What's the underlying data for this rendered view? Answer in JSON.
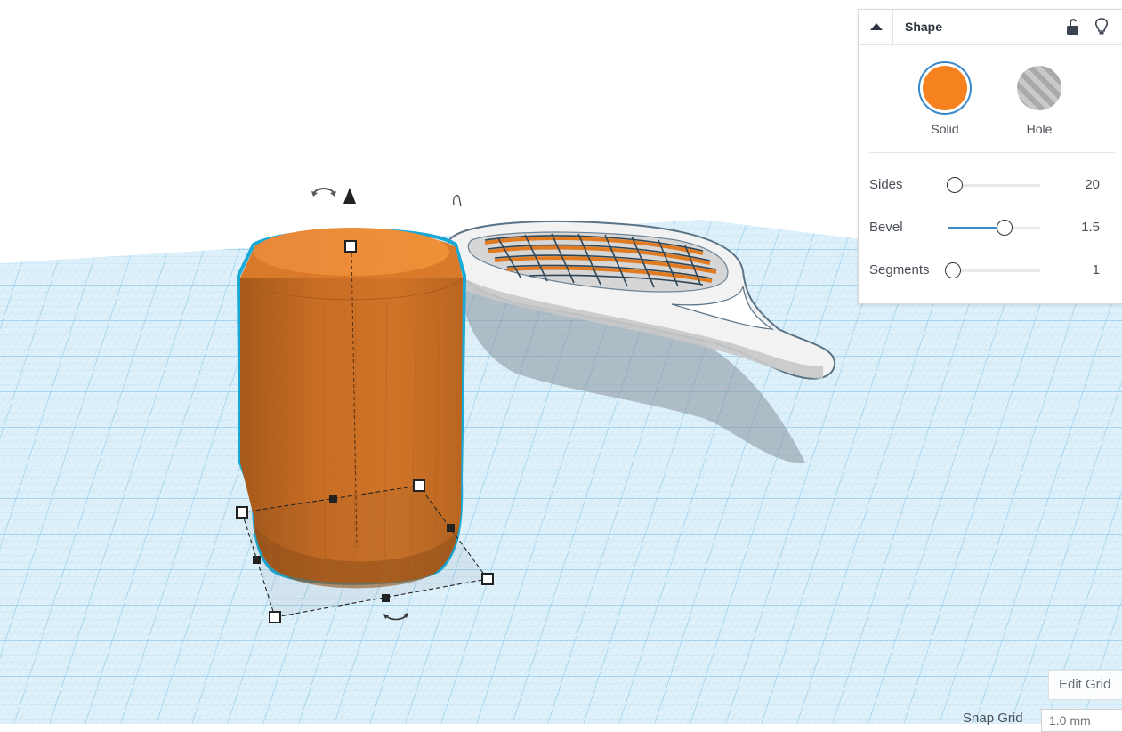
{
  "shape_panel": {
    "title": "Shape",
    "solid_label": "Solid",
    "hole_label": "Hole",
    "solid_color": "#f5821f",
    "selected_type": "Solid",
    "icons": [
      "collapse-triangle-icon",
      "unlock-icon",
      "lightbulb-icon"
    ],
    "properties": [
      {
        "label": "Sides",
        "value": "20",
        "fraction": 0.02
      },
      {
        "label": "Bevel",
        "value": "1.5",
        "fraction": 0.63
      },
      {
        "label": "Segments",
        "value": "1",
        "fraction": 0.0
      }
    ]
  },
  "workplane": {
    "edit_grid_label": "Edit Grid",
    "snap_grid_label": "Snap Grid",
    "snap_grid_value": "1.0 mm",
    "grid_color": "#a9d6ee"
  }
}
